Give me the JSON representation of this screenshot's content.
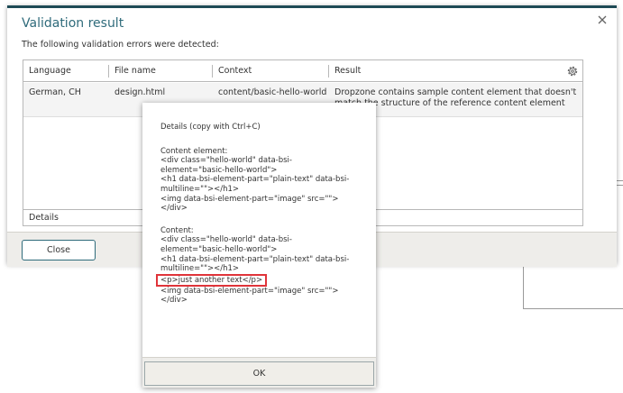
{
  "dialog": {
    "title": "Validation result",
    "intro": "The following validation errors were detected:",
    "close_label": "Close"
  },
  "table": {
    "columns": [
      "Language",
      "File name",
      "Context",
      "Result"
    ],
    "rows": [
      {
        "language": "German, CH",
        "file": "design.html",
        "context": "content/basic-hello-world",
        "result_line1": "Dropzone contains sample content element that doesn't",
        "result_line2": "match the structure of the reference content element"
      }
    ],
    "footer_label": "Details"
  },
  "popup": {
    "heading": "Details (copy with Ctrl+C)",
    "element_label": "Content element:",
    "element_lines": [
      "<div class=\"hello-world\" data-bsi-",
      "element=\"basic-hello-world\">",
      "<h1 data-bsi-element-part=\"plain-text\" data-bsi-",
      "multiline=\"\"></h1>",
      "<img data-bsi-element-part=\"image\" src=\"\">",
      "</div>"
    ],
    "content_label": "Content:",
    "content_lines_before": [
      "<div class=\"hello-world\" data-bsi-",
      "element=\"basic-hello-world\">",
      "<h1 data-bsi-element-part=\"plain-text\" data-bsi-",
      "multiline=\"\"></h1>"
    ],
    "content_highlight": "<p>just another text</p>",
    "content_lines_after": [
      "<img data-bsi-element-part=\"image\" src=\"\">",
      "</div>"
    ],
    "ok_label": "OK"
  },
  "colors": {
    "title": "#2f6b7b",
    "header_border": "#1d4a55",
    "highlight_border": "#e0343a",
    "footer_bg": "#eeedea"
  },
  "icons": {
    "close": "close-icon",
    "settings": "gear-icon"
  }
}
